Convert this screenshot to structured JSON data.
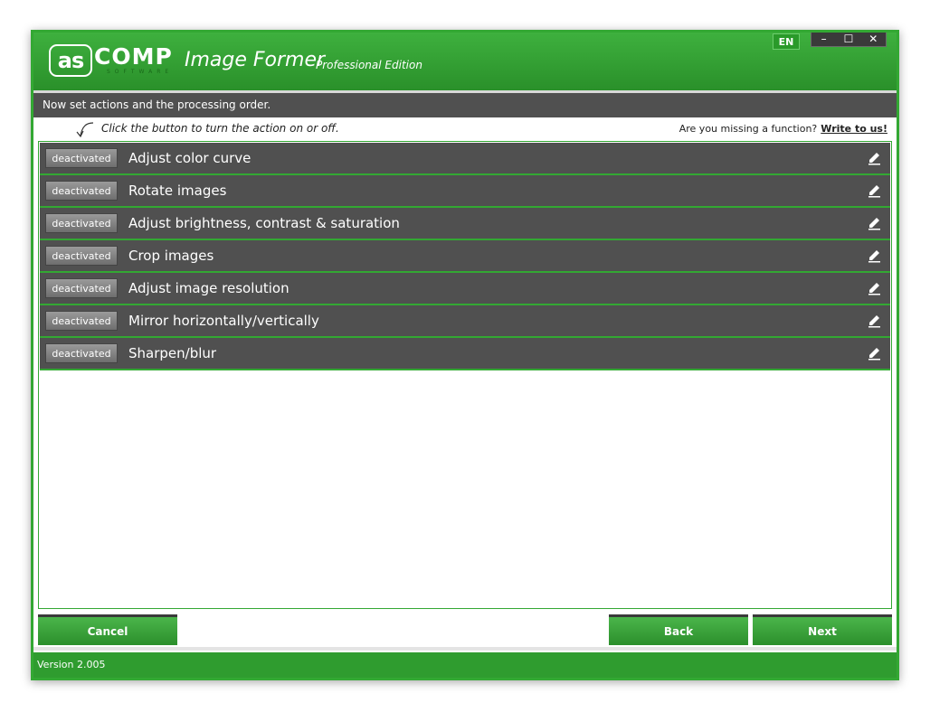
{
  "header": {
    "logo_mark": "as",
    "logo_word": "COMP",
    "logo_sub": "SOFTWARE",
    "app_name": "Image Former",
    "edition": "Professional Edition",
    "language": "EN",
    "window_controls": {
      "minimize": "–",
      "maximize": "☐",
      "close": "✕"
    }
  },
  "subheader": {
    "instruction": "Now set actions and the processing order."
  },
  "hint": {
    "text": "Click the button to turn the action on or off.",
    "missing_text": "Are you missing a function?",
    "missing_link": "Write to us!"
  },
  "actions": [
    {
      "state": "deactivated",
      "label": "Adjust color curve"
    },
    {
      "state": "deactivated",
      "label": "Rotate images"
    },
    {
      "state": "deactivated",
      "label": "Adjust brightness, contrast & saturation"
    },
    {
      "state": "deactivated",
      "label": "Crop images"
    },
    {
      "state": "deactivated",
      "label": "Adjust image resolution"
    },
    {
      "state": "deactivated",
      "label": "Mirror horizontally/vertically"
    },
    {
      "state": "deactivated",
      "label": "Sharpen/blur"
    }
  ],
  "footer": {
    "cancel": "Cancel",
    "back": "Back",
    "next": "Next"
  },
  "status": {
    "version": "Version 2.005"
  },
  "colors": {
    "accent": "#33a833",
    "row_bg": "#505050"
  }
}
